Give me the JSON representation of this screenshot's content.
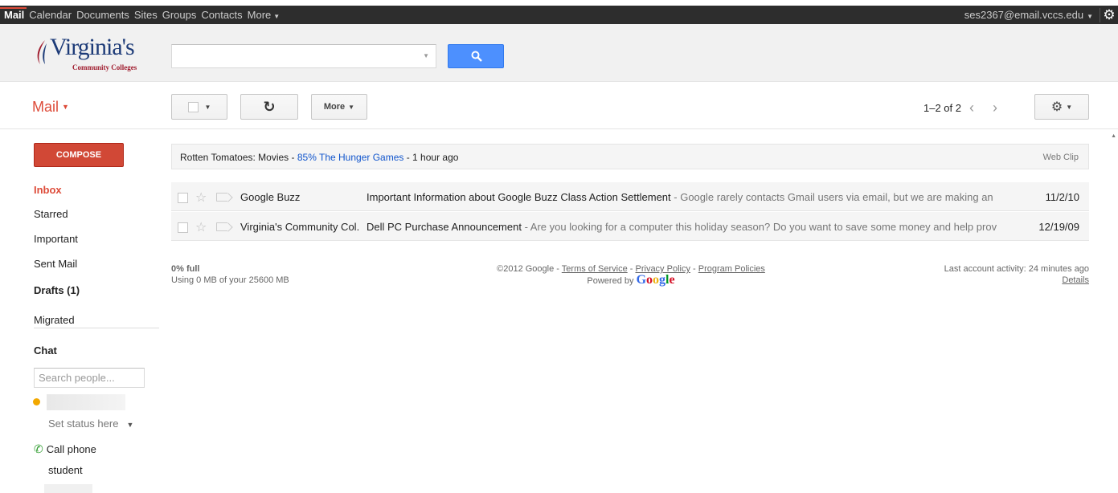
{
  "topbar": {
    "nav": [
      "Mail",
      "Calendar",
      "Documents",
      "Sites",
      "Groups",
      "Contacts",
      "More"
    ],
    "account": "ses2367@email.vccs.edu"
  },
  "header": {
    "logo_name": "Virginia's",
    "logo_sub": "Community Colleges",
    "search_value": ""
  },
  "toolbar": {
    "mail_label": "Mail",
    "more_label": "More",
    "pager": "1–2 of 2"
  },
  "sidebar": {
    "compose": "COMPOSE",
    "items": [
      {
        "label": "Inbox"
      },
      {
        "label": "Starred"
      },
      {
        "label": "Important"
      },
      {
        "label": "Sent Mail"
      },
      {
        "label": "Drafts (1)"
      },
      {
        "label": "Migrated"
      }
    ],
    "chat_label": "Chat",
    "chat_search_placeholder": "Search people...",
    "status": "Set status here",
    "call_phone": "Call phone",
    "contact": "student"
  },
  "webclip": {
    "source": "Rotten Tomatoes: Movies",
    "link": "85% The Hunger Games",
    "time": "1 hour ago",
    "tag": "Web Clip"
  },
  "emails": [
    {
      "from": "Google Buzz",
      "subject": "Important Information about Google Buzz Class Action Settlement",
      "snippet": "Google rarely contacts Gmail users via email, but we are making an",
      "date": "11/2/10"
    },
    {
      "from": "Virginia's Community Col.",
      "subject": "Dell PC Purchase Announcement",
      "snippet": "Are you looking for a computer this holiday season? Do you want to save some money and help prov",
      "date": "12/19/09"
    }
  ],
  "footer": {
    "usage_pct": "0% full",
    "usage": "Using 0 MB of your 25600 MB",
    "copyright": "©2012 Google -",
    "tos": "Terms of Service",
    "privacy": "Privacy Policy",
    "policies": "Program Policies",
    "powered": "Powered by",
    "google": "Google",
    "activity": "Last account activity: 24 minutes ago",
    "details": "Details"
  }
}
